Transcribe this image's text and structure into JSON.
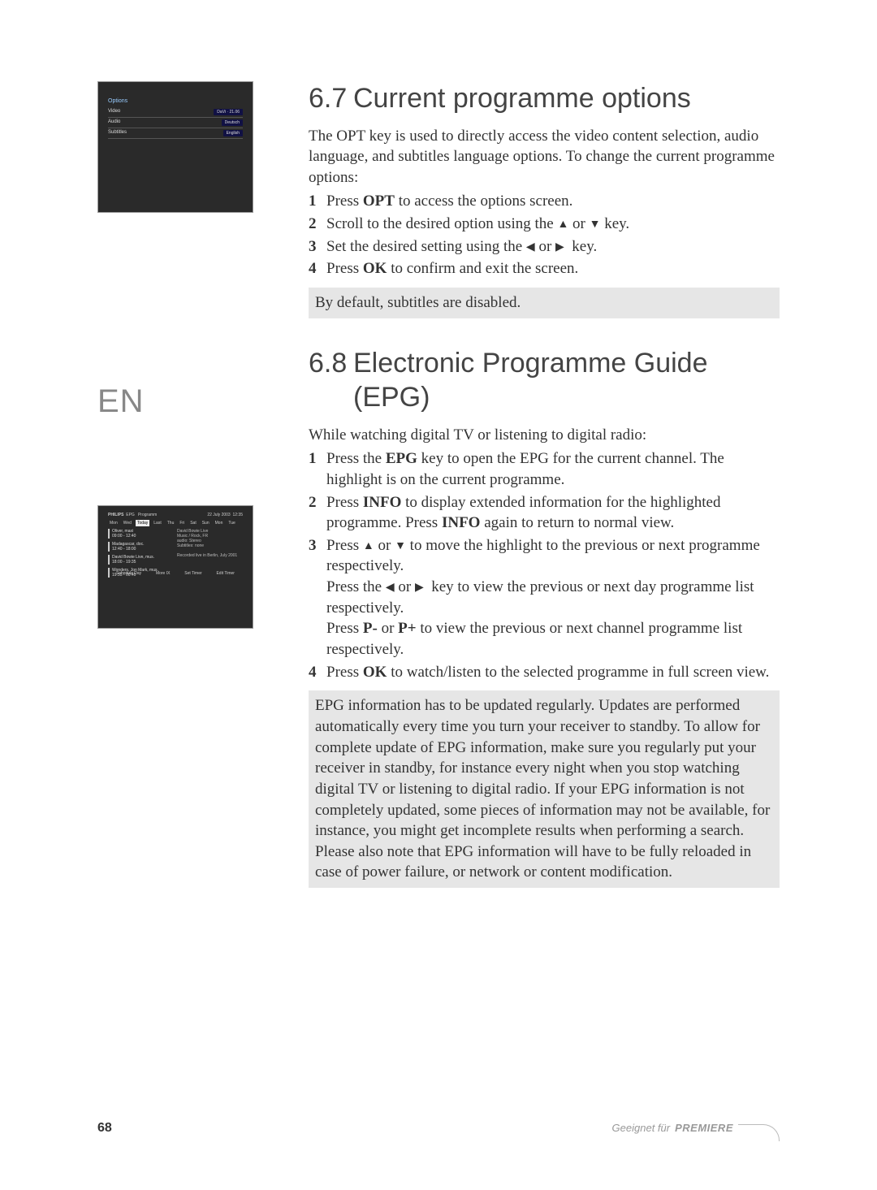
{
  "lang_badge": "EN",
  "screenshot1": {
    "title": "Options",
    "rows": [
      {
        "label": "Video",
        "value": "DaVi · 21.06"
      },
      {
        "label": "Audio",
        "value": "Deutsch"
      },
      {
        "label": "Subtitles",
        "value": "English"
      }
    ]
  },
  "screenshot2": {
    "brand": "PHILIPS",
    "channel": "EPG",
    "prog_label": "Programm",
    "date": "22 July 2003",
    "time": "12:35",
    "tabs": [
      "Mon",
      "Wed",
      "Today",
      "Last",
      "Thu",
      "Fri",
      "Sat",
      "Sun",
      "Mon",
      "Tue"
    ],
    "items": [
      {
        "title": "Oliver, maxi",
        "time": "09:00 - 12:40"
      },
      {
        "title": "Madagascar, doc.",
        "time": "12:40 - 18:00"
      },
      {
        "title": "David Bowie Live, mus.",
        "time": "18:00 - 19:35"
      },
      {
        "title": "Wonders, Jon Mark, mus.",
        "time": "19:35 - 00:40"
      }
    ],
    "info_lines": [
      "David Bowie Live",
      "Music / Rock, FR",
      "audio: Stereo",
      "Subtitles: none"
    ],
    "info_extra": "Recorded live in Berlin, July 2001",
    "footer": {
      "schedule": "Schedule Day",
      "info": "More IX",
      "settimer": "Set Timer",
      "edittimer": "Edit Timer"
    }
  },
  "section67": {
    "num": "6.7",
    "title": "Current programme options",
    "intro": "The OPT key is used to directly access the video content selection, audio language, and subtitles language options. To change the current programme options:",
    "steps": [
      {
        "n": "1",
        "html": "Press <strong>OPT</strong> to access the options screen."
      },
      {
        "n": "2",
        "html": "Scroll to the desired option using the <span class='tri-up'></span> or <span class='tri-down'></span> key."
      },
      {
        "n": "3",
        "html": "Set the desired setting using the <span class='tri-left'></span> or <span class='tri-right'></span> &nbsp;key."
      },
      {
        "n": "4",
        "html": "Press <strong>OK</strong> to confirm and exit the screen."
      }
    ],
    "note": "By default, subtitles are disabled."
  },
  "section68": {
    "num": "6.8",
    "title": "Electronic Programme Guide (EPG)",
    "intro": "While watching digital TV or listening to digital radio:",
    "steps": [
      {
        "n": "1",
        "html": "Press the <strong>EPG</strong> key to open the EPG for the current channel. The highlight is on the current programme."
      },
      {
        "n": "2",
        "html": "Press <strong>INFO</strong> to display extended information for the highlighted programme. Press <strong>INFO</strong> again to return to normal view."
      },
      {
        "n": "3",
        "html": "Press <span class='tri-up'></span> or <span class='tri-down'></span> to move the highlight to the previous or next programme respectively.<br>Press the <span class='tri-left'></span> or <span class='tri-right'></span> &nbsp;key to view the previous or next day programme list respectively.<br>Press <strong>P-</strong> or <strong>P+</strong> to view the previous or next channel programme list respectively."
      },
      {
        "n": "4",
        "html": "Press <strong>OK</strong> to watch/listen to the selected programme in full screen view."
      }
    ],
    "note": "EPG information has to be updated regularly. Updates are performed automatically every time you turn your receiver to standby. To allow for complete update of EPG information, make sure you regularly put your receiver in standby, for instance every night when you stop watching digital TV or listening to digital radio. If your EPG information is not completely updated, some pieces of information may not be available, for instance, you might get incomplete results when performing a search. Please also note that EPG information will have to be fully reloaded in case of power failure, or network or content modification."
  },
  "footer": {
    "page_num": "68",
    "premiere_prefix": "Geeignet für",
    "premiere_brand": "PREMIERE"
  }
}
